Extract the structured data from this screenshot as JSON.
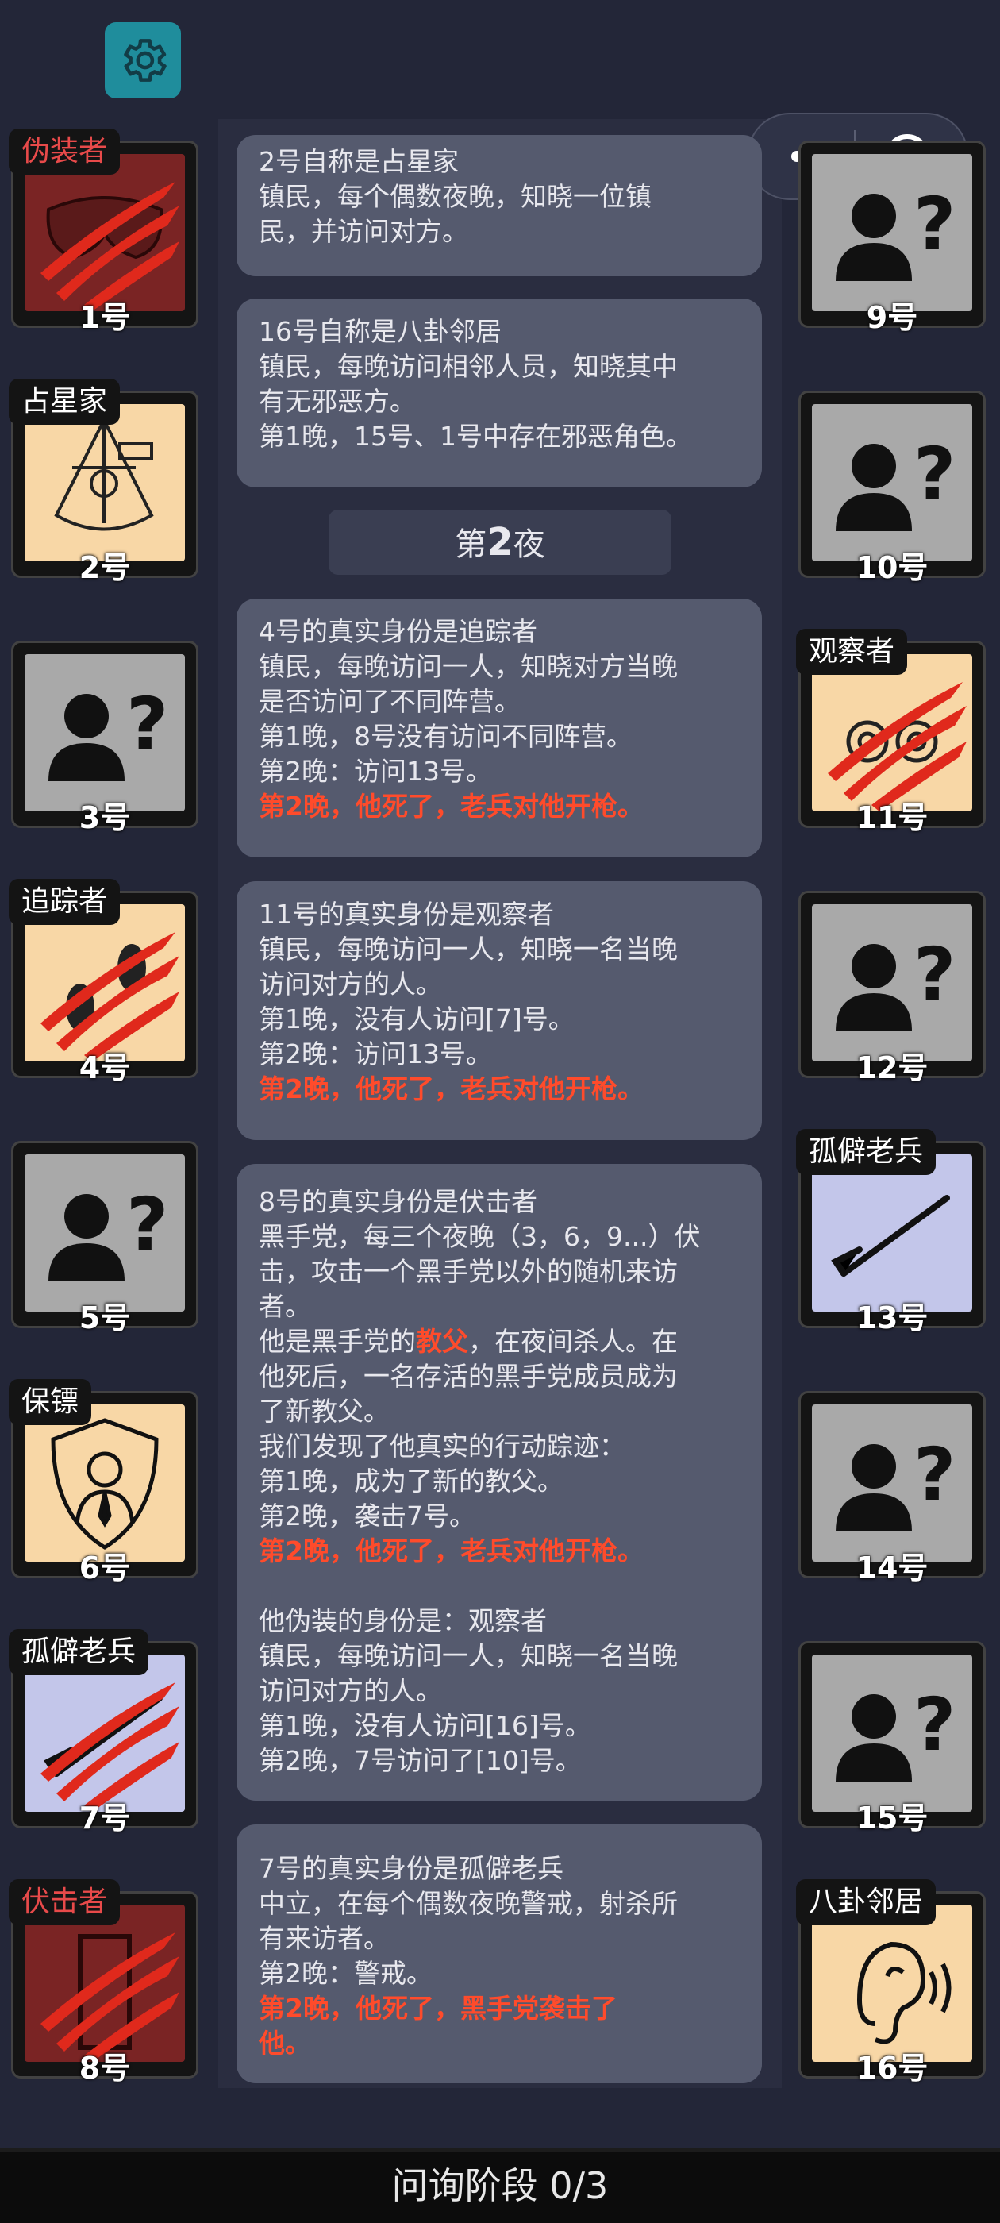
{
  "settings": {
    "icon": "gear-icon"
  },
  "mini_program": {
    "more_icon": "more-dots-icon",
    "close_icon": "target-close-icon"
  },
  "players_left": [
    {
      "number": "1号",
      "role": "伪装者",
      "tag_color": "#e84a4a",
      "bg": "red",
      "icon": "mask-icon",
      "slashed": true
    },
    {
      "number": "2号",
      "role": "占星家",
      "tag_color": "#ffffff",
      "bg": "cream",
      "icon": "sextant-icon",
      "slashed": false
    },
    {
      "number": "3号",
      "role": "",
      "bg": "grey",
      "icon": "unknown-person-icon",
      "slashed": false
    },
    {
      "number": "4号",
      "role": "追踪者",
      "tag_color": "#ffffff",
      "bg": "cream",
      "icon": "footprints-icon",
      "slashed": true
    },
    {
      "number": "5号",
      "role": "",
      "bg": "grey",
      "icon": "unknown-person-icon",
      "slashed": false
    },
    {
      "number": "6号",
      "role": "保镖",
      "tag_color": "#ffffff",
      "bg": "cream",
      "icon": "bodyguard-shield-icon",
      "slashed": false
    },
    {
      "number": "7号",
      "role": "孤僻老兵",
      "tag_color": "#ffffff",
      "bg": "lav",
      "icon": "rifle-icon",
      "slashed": true
    },
    {
      "number": "8号",
      "role": "伏击者",
      "tag_color": "#e84a4a",
      "bg": "red",
      "icon": "door-icon",
      "slashed": true
    }
  ],
  "players_right": [
    {
      "number": "9号",
      "role": "",
      "bg": "grey",
      "icon": "unknown-person-icon",
      "slashed": false
    },
    {
      "number": "10号",
      "role": "",
      "bg": "grey",
      "icon": "unknown-person-icon",
      "slashed": false
    },
    {
      "number": "11号",
      "role": "观察者",
      "tag_color": "#ffffff",
      "bg": "cream",
      "icon": "binoculars-icon",
      "slashed": true
    },
    {
      "number": "12号",
      "role": "",
      "bg": "grey",
      "icon": "unknown-person-icon",
      "slashed": false
    },
    {
      "number": "13号",
      "role": "孤僻老兵",
      "tag_color": "#ffffff",
      "bg": "lav",
      "icon": "rifle-icon",
      "slashed": false
    },
    {
      "number": "14号",
      "role": "",
      "bg": "grey",
      "icon": "unknown-person-icon",
      "slashed": false
    },
    {
      "number": "15号",
      "role": "",
      "bg": "grey",
      "icon": "unknown-person-icon",
      "slashed": false
    },
    {
      "number": "16号",
      "role": "八卦邻居",
      "tag_color": "#ffffff",
      "bg": "cream",
      "icon": "ear-icon",
      "slashed": false
    }
  ],
  "log": {
    "p1": [
      "2号自称是占星家",
      "镇民，每个偶数夜晚，知晓一位镇",
      "民，并访问对方。"
    ],
    "p2": [
      "16号自称是八卦邻居",
      "镇民，每晚访问相邻人员，知晓其中",
      "有无邪恶方。",
      "第1晚，15号、1号中存在邪恶角色。"
    ],
    "night_prefix": "第",
    "night_num": "2",
    "night_suffix": "夜",
    "p3": [
      "4号的真实身份是追踪者",
      "镇民，每晚访问一人，知晓对方当晚",
      "是否访问了不同阵营。",
      "第1晚，8号没有访问不同阵营。",
      "第2晚：访问13号。"
    ],
    "p3_red": "第2晚，他死了，老兵对他开枪。",
    "p4": [
      "11号的真实身份是观察者",
      "镇民，每晚访问一人，知晓一名当晚",
      "访问对方的人。",
      "第1晚，没有人访问[7]号。",
      "第2晚：访问13号。"
    ],
    "p4_red": "第2晚，他死了，老兵对他开枪。",
    "p5_a": [
      "8号的真实身份是伏击者",
      "黑手党，每三个夜晚（3，6，9...）伏",
      "击，攻击一个黑手党以外的随机来访",
      "者。"
    ],
    "p5_godfather_pre": "他是黑手党的",
    "p5_godfather": "教父",
    "p5_godfather_post": "，在夜间杀人。在",
    "p5_b": [
      "他死后，一名存活的黑手党成员成为",
      "了新教父。",
      "我们发现了他真实的行动踪迹：",
      "第1晚，成为了新的教父。",
      "第2晚，袭击7号。"
    ],
    "p5_red": "第2晚，他死了，老兵对他开枪。",
    "p5_c": [
      "他伪装的身份是：观察者",
      "镇民，每晚访问一人，知晓一名当晚",
      "访问对方的人。",
      "第1晚，没有人访问[16]号。",
      "第2晚，7号访问了[10]号。"
    ],
    "p6": [
      "7号的真实身份是孤僻老兵",
      "中立，在每个偶数夜晚警戒，射杀所",
      "有来访者。",
      "第2晚：警戒。"
    ],
    "p6_red": [
      "第2晚，他死了，黑手党袭击了",
      "他。"
    ]
  },
  "status": {
    "label": "问询阶段 0/3"
  },
  "colors": {
    "accent_red": "#ff4b2b",
    "panel": "#555a6e",
    "gear": "#1f8d9c"
  }
}
